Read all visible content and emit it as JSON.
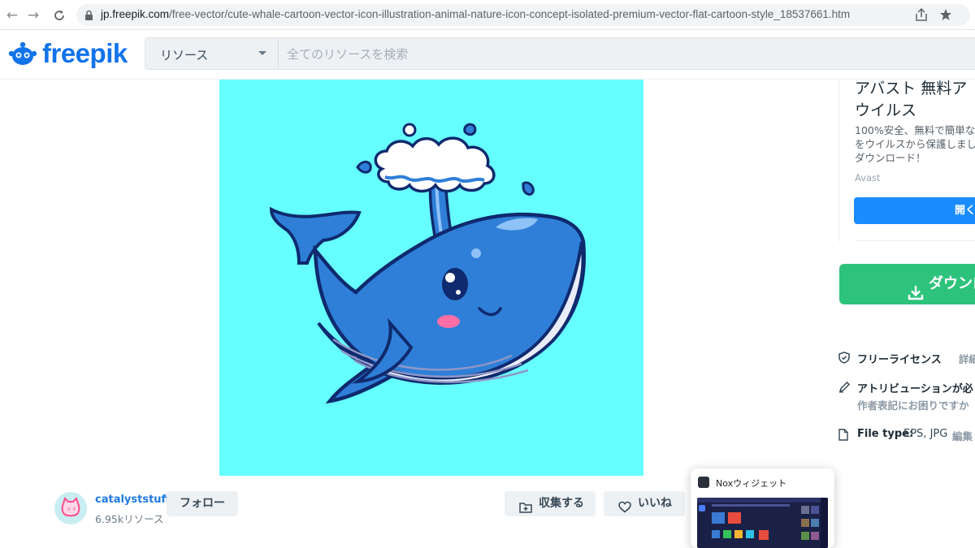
{
  "browser": {
    "url_domain": "jp.freepik.com",
    "url_path": "/free-vector/cute-whale-cartoon-vector-icon-illustration-animal-nature-icon-concept-isolated-premium-vector-flat-cartoon-style_18537661.htm"
  },
  "header": {
    "logo_text": "freepik",
    "resource_select": "リソース",
    "search_placeholder": "全てのリソースを検索"
  },
  "author": {
    "name": "catalyststuff",
    "resources": "6.95kリソース",
    "follow_label": "フォロー"
  },
  "actions": {
    "collect_label": "収集する",
    "like_label": "いいね"
  },
  "ad": {
    "title_line1": "アバスト 無料ア",
    "title_line2": "ウイルス",
    "body_line1": "100%安全、無料で簡単な",
    "body_line2": "をウイルスから保護しまし",
    "body_line3": "ダウンロード！",
    "source": "Avast",
    "open_label": "開く"
  },
  "download": {
    "label": "ダウンロ"
  },
  "info": {
    "license_label": "フリーライセンス",
    "license_detail": "詳細",
    "attribution_label": "アトリビューションが必",
    "attribution_help": "作者表記にお困りですか",
    "filetype_label": "File type:",
    "filetype_value": "EPS, JPG",
    "filetype_edit": "編集"
  },
  "nox": {
    "title": "Noxウィジェット"
  },
  "colors": {
    "brand": "#1273eb",
    "download_green": "#2ec37c",
    "ad_button": "#1a8cff",
    "image_bg": "#66ffff"
  }
}
